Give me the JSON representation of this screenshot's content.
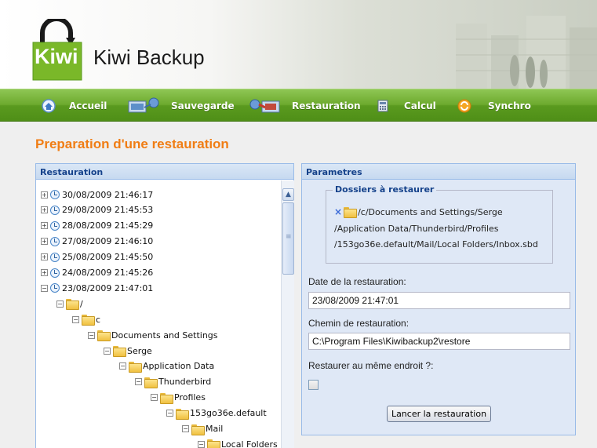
{
  "app": {
    "title": "Kiwi Backup",
    "logo_text": "Kiwi"
  },
  "nav": [
    {
      "label": "Accueil",
      "icon": "home-icon"
    },
    {
      "label": "Sauvegarde",
      "icon": "backup-icon"
    },
    {
      "label": "Restauration",
      "icon": "restore-icon"
    },
    {
      "label": "Calcul",
      "icon": "calculator-icon"
    },
    {
      "label": "Synchro",
      "icon": "sync-icon"
    }
  ],
  "page_title": "Preparation d'une restauration",
  "left_panel": {
    "title": "Restauration",
    "tree": [
      {
        "label": "30/08/2009 21:46:17",
        "kind": "snapshot",
        "toggle": "+"
      },
      {
        "label": "29/08/2009 21:45:53",
        "kind": "snapshot",
        "toggle": "+"
      },
      {
        "label": "28/08/2009 21:45:29",
        "kind": "snapshot",
        "toggle": "+"
      },
      {
        "label": "27/08/2009 21:46:10",
        "kind": "snapshot",
        "toggle": "+"
      },
      {
        "label": "25/08/2009 21:45:50",
        "kind": "snapshot",
        "toggle": "+"
      },
      {
        "label": "24/08/2009 21:45:26",
        "kind": "snapshot",
        "toggle": "+"
      },
      {
        "label": "23/08/2009 21:47:01",
        "kind": "snapshot",
        "toggle": "−"
      },
      {
        "label": "/",
        "kind": "folder",
        "toggle": "−"
      },
      {
        "label": "c",
        "kind": "folder",
        "toggle": "−"
      },
      {
        "label": "Documents and Settings",
        "kind": "folder",
        "toggle": "−"
      },
      {
        "label": "Serge",
        "kind": "folder",
        "toggle": "−"
      },
      {
        "label": "Application Data",
        "kind": "folder",
        "toggle": "−"
      },
      {
        "label": "Thunderbird",
        "kind": "folder",
        "toggle": "−"
      },
      {
        "label": "Profiles",
        "kind": "folder",
        "toggle": "−"
      },
      {
        "label": "153go36e.default",
        "kind": "folder",
        "toggle": "−"
      },
      {
        "label": "Mail",
        "kind": "folder",
        "toggle": "−"
      },
      {
        "label": "Local Folders",
        "kind": "folder",
        "toggle": "−"
      }
    ]
  },
  "right_panel": {
    "title": "Parametres",
    "folders_legend": "Dossiers à restaurer",
    "selected_path": [
      "/c/Documents and Settings/Serge",
      "/Application Data/Thunderbird/Profiles",
      "/153go36e.default/Mail/Local Folders/Inbox.sbd"
    ],
    "date_label": "Date de la restauration:",
    "date_value": "23/08/2009 21:47:01",
    "path_label": "Chemin de restauration:",
    "path_value": "C:\\Program Files\\Kiwibackup2\\restore",
    "same_place_label": "Restaurer au même endroit ?:",
    "same_place_checked": false,
    "launch_button": "Lancer la restauration"
  },
  "colors": {
    "nav_green": "#6daa2e",
    "title_orange": "#f07d14",
    "panel_header_text": "#15428b",
    "panel_border": "#99bbe8"
  }
}
